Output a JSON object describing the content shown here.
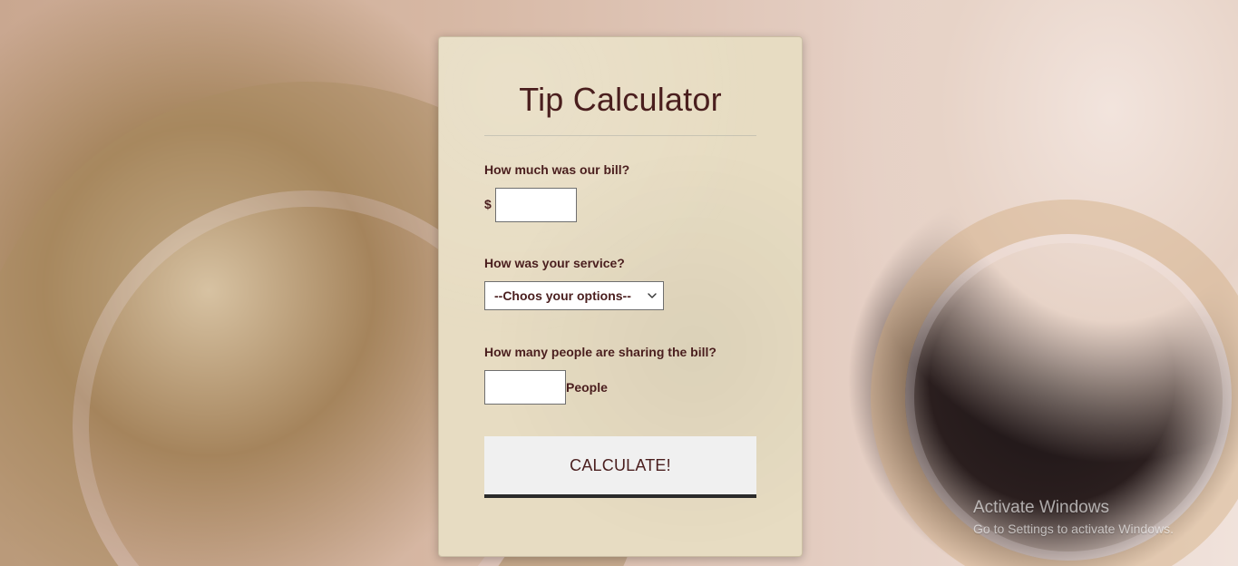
{
  "page": {
    "title": "Tip Calculator"
  },
  "form": {
    "bill_question": "How much was our bill?",
    "currency_symbol": "$",
    "bill_value": "",
    "service_question": "How was your service?",
    "service_selected": "--Choos your options--",
    "people_question": "How many people are sharing the bill?",
    "people_value": "",
    "people_suffix": "People",
    "calculate_label": "CALCULATE!"
  },
  "watermark": {
    "title": "Activate Windows",
    "subtitle": "Go to Settings to activate Windows."
  },
  "icons": {
    "select_chevron": "chevron-down-icon"
  },
  "colors": {
    "text_primary": "#4a1e1e",
    "card_bg": "#e7dcc2",
    "button_bg": "#f0f0f0",
    "button_border": "#2a2a2a"
  }
}
